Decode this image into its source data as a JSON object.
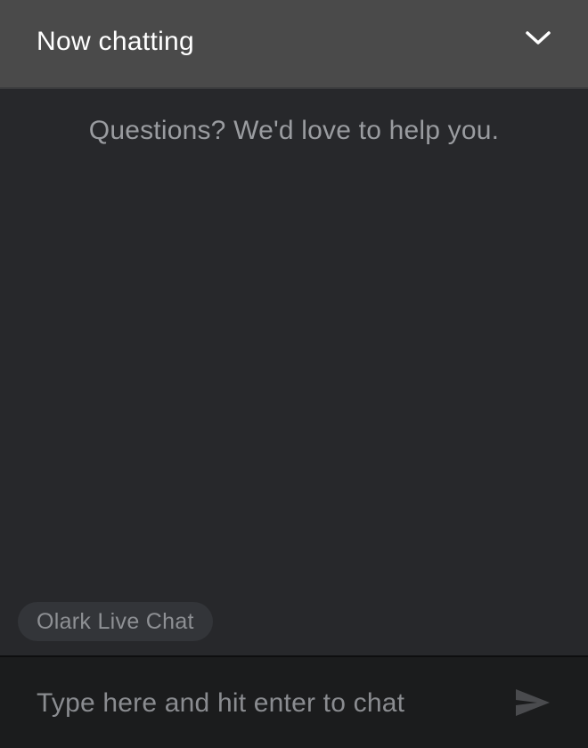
{
  "header": {
    "title": "Now chatting",
    "toggle_icon": "chevron-down-icon"
  },
  "body": {
    "welcome_message": "Questions? We'd love to help you.",
    "branding_label": "Olark Live Chat"
  },
  "composer": {
    "placeholder": "Type here and hit enter to chat",
    "value": "",
    "send_icon": "send-icon"
  },
  "colors": {
    "header_bg": "#4a4a4a",
    "body_bg": "#27282b",
    "composer_bg": "#1b1c1d",
    "text_primary": "#ffffff",
    "text_muted": "#9a9ca0"
  }
}
